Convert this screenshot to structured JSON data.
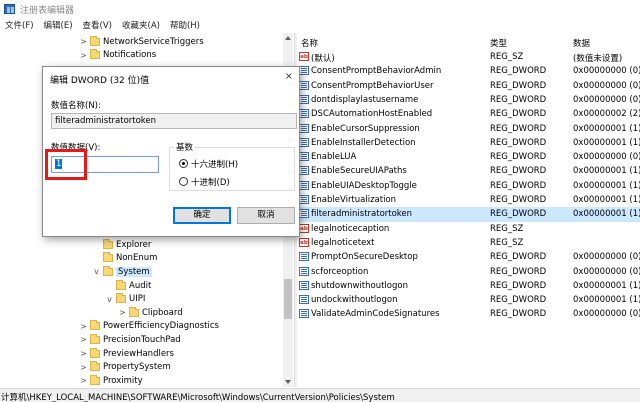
{
  "window": {
    "title": "注册表编辑器"
  },
  "menu": [
    "文件(F)",
    "编辑(E)",
    "查看(V)",
    "收藏夹(A)",
    "帮助(H)"
  ],
  "tree": {
    "items": [
      {
        "label": "NetworkServiceTriggers",
        "indent": 3,
        "chev": ">"
      },
      {
        "label": "Notifications",
        "indent": 3,
        "chev": ">"
      },
      {
        "label": "Explorer",
        "indent": 4,
        "chev": ""
      },
      {
        "label": "NonEnum",
        "indent": 4,
        "chev": ""
      },
      {
        "label": "System",
        "indent": 4,
        "chev": "v",
        "selected": true
      },
      {
        "label": "Audit",
        "indent": 5,
        "chev": ""
      },
      {
        "label": "UIPI",
        "indent": 5,
        "chev": "v"
      },
      {
        "label": "Clipboard",
        "indent": 6,
        "chev": ">"
      },
      {
        "label": "PowerEfficiencyDiagnostics",
        "indent": 3,
        "chev": ">"
      },
      {
        "label": "PrecisionTouchPad",
        "indent": 3,
        "chev": ">"
      },
      {
        "label": "PreviewHandlers",
        "indent": 3,
        "chev": ">"
      },
      {
        "label": "PropertySystem",
        "indent": 3,
        "chev": ">"
      },
      {
        "label": "Proximity",
        "indent": 3,
        "chev": ">"
      }
    ]
  },
  "list": {
    "headers": {
      "name": "名称",
      "type": "类型",
      "data": "数据"
    },
    "rows": [
      {
        "icon": "sz",
        "name": "(默认)",
        "type": "REG_SZ",
        "data": "(数值未设置)"
      },
      {
        "icon": "dword",
        "name": "ConsentPromptBehaviorAdmin",
        "type": "REG_DWORD",
        "data": "0x00000000 (0)"
      },
      {
        "icon": "dword",
        "name": "ConsentPromptBehaviorUser",
        "type": "REG_DWORD",
        "data": "0x00000000 (0)"
      },
      {
        "icon": "dword",
        "name": "dontdisplaylastusername",
        "type": "REG_DWORD",
        "data": "0x00000000 (0)"
      },
      {
        "icon": "dword",
        "name": "DSCAutomationHostEnabled",
        "type": "REG_DWORD",
        "data": "0x00000002 (2)"
      },
      {
        "icon": "dword",
        "name": "EnableCursorSuppression",
        "type": "REG_DWORD",
        "data": "0x00000001 (1)"
      },
      {
        "icon": "dword",
        "name": "EnableInstallerDetection",
        "type": "REG_DWORD",
        "data": "0x00000001 (1)"
      },
      {
        "icon": "dword",
        "name": "EnableLUA",
        "type": "REG_DWORD",
        "data": "0x00000000 (0)"
      },
      {
        "icon": "dword",
        "name": "EnableSecureUIAPaths",
        "type": "REG_DWORD",
        "data": "0x00000001 (1)"
      },
      {
        "icon": "dword",
        "name": "EnableUIADesktopToggle",
        "type": "REG_DWORD",
        "data": "0x00000001 (1)"
      },
      {
        "icon": "dword",
        "name": "EnableVirtualization",
        "type": "REG_DWORD",
        "data": "0x00000001 (1)"
      },
      {
        "icon": "dword",
        "name": "filteradministratortoken",
        "type": "REG_DWORD",
        "data": "0x00000001 (1)",
        "selected": true
      },
      {
        "icon": "sz",
        "name": "legalnoticecaption",
        "type": "REG_SZ",
        "data": ""
      },
      {
        "icon": "sz",
        "name": "legalnoticetext",
        "type": "REG_SZ",
        "data": ""
      },
      {
        "icon": "dword",
        "name": "PromptOnSecureDesktop",
        "type": "REG_DWORD",
        "data": "0x00000000 (0)"
      },
      {
        "icon": "dword",
        "name": "scforceoption",
        "type": "REG_DWORD",
        "data": "0x00000000 (0)"
      },
      {
        "icon": "dword",
        "name": "shutdownwithoutlogon",
        "type": "REG_DWORD",
        "data": "0x00000001 (1)"
      },
      {
        "icon": "dword",
        "name": "undockwithoutlogon",
        "type": "REG_DWORD",
        "data": "0x00000001 (1)"
      },
      {
        "icon": "dword",
        "name": "ValidateAdminCodeSignatures",
        "type": "REG_DWORD",
        "data": "0x00000000 (0)"
      }
    ]
  },
  "dialog": {
    "title": "编辑 DWORD (32 位)值",
    "close": "×",
    "name_label": "数值名称(N):",
    "name_value": "filteradministratortoken",
    "data_label": "数值数据(V):",
    "data_value": "1",
    "base_label": "基数",
    "hex_label": "十六进制(H)",
    "dec_label": "十进制(D)",
    "base_selected": "hex",
    "ok": "确定",
    "cancel": "取消"
  },
  "status": {
    "path": "计算机\\HKEY_LOCAL_MACHINE\\SOFTWARE\\Microsoft\\Windows\\CurrentVersion\\Policies\\System"
  },
  "colors": {
    "selection": "#cce8ff",
    "highlight_box": "#e21a1a",
    "accent": "#0078d7"
  }
}
